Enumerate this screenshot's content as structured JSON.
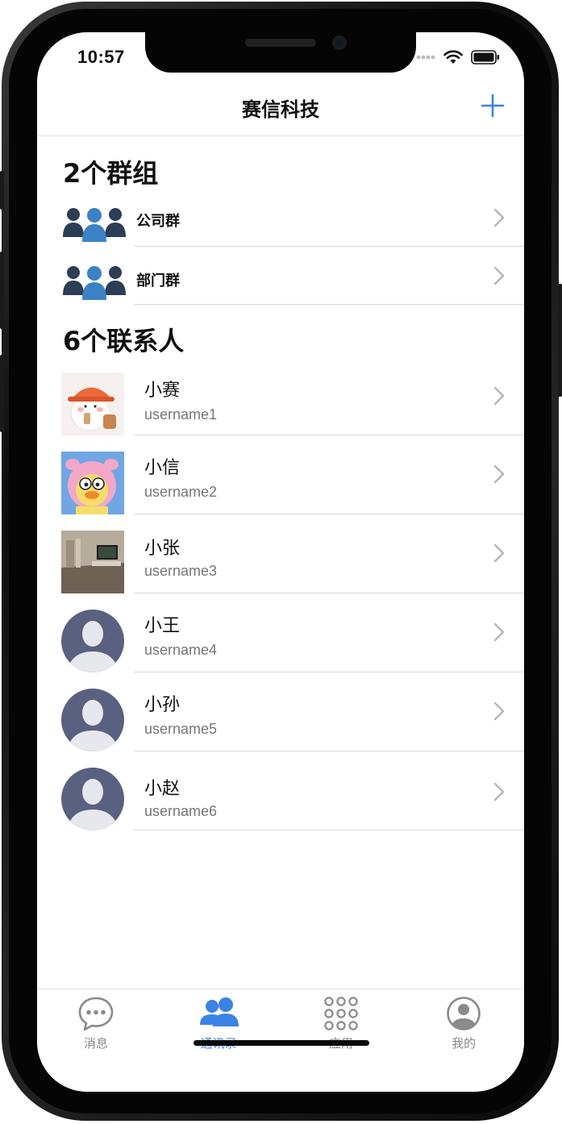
{
  "status_bar": {
    "time": "10:57"
  },
  "nav": {
    "title": "赛信科技",
    "add_icon": "plus-icon"
  },
  "groups": {
    "section_title": "2个群组",
    "items": [
      {
        "name": "公司群",
        "icon": "group-icon"
      },
      {
        "name": "部门群",
        "icon": "group-icon"
      }
    ]
  },
  "contacts": {
    "section_title": "6个联系人",
    "items": [
      {
        "name": "小赛",
        "username": "username1",
        "avatar": "cartoon-bear-avatar"
      },
      {
        "name": "小信",
        "username": "username2",
        "avatar": "cartoon-pig-avatar"
      },
      {
        "name": "小张",
        "username": "username3",
        "avatar": "room-photo-avatar"
      },
      {
        "name": "小王",
        "username": "username4",
        "avatar": "default-person-avatar"
      },
      {
        "name": "小孙",
        "username": "username5",
        "avatar": "default-person-avatar"
      },
      {
        "name": "小赵",
        "username": "username6",
        "avatar": "default-person-avatar"
      }
    ]
  },
  "tabbar": {
    "tabs": [
      {
        "label": "消息",
        "icon": "chat-bubble-icon",
        "active": false
      },
      {
        "label": "通讯录",
        "icon": "contacts-icon",
        "active": true
      },
      {
        "label": "应用",
        "icon": "apps-grid-icon",
        "active": false
      },
      {
        "label": "我的",
        "icon": "profile-icon",
        "active": false
      }
    ]
  },
  "colors": {
    "accent": "#3b82e6",
    "group_icon_dark": "#2c3e55",
    "group_icon_blue": "#3b82c4",
    "default_avatar": "#5a6180"
  }
}
